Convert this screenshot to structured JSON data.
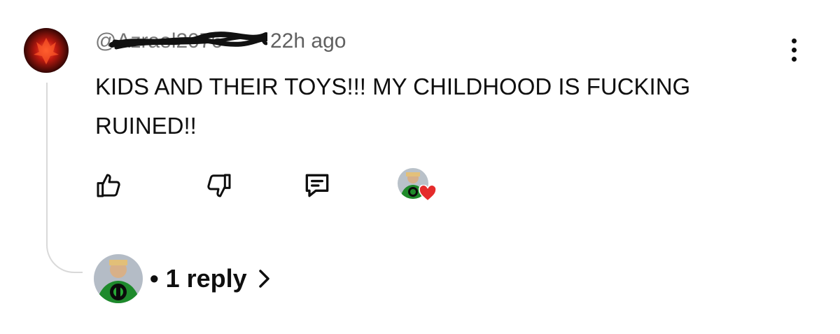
{
  "comment": {
    "author_handle": "@Azrael2076",
    "time_ago": "22h ago",
    "text": "KIDS AND THEIR TOYS!!! MY CHILDHOOD IS FUCKING RUINED!!"
  },
  "actions": {
    "like_icon": "thumbs-up-icon",
    "dislike_icon": "thumbs-down-icon",
    "reply_icon": "comment-icon",
    "creator_heart_icon": "heart-icon"
  },
  "replies": {
    "label": "• 1 reply"
  },
  "colors": {
    "heart": "#e52b2b",
    "thread_line": "#d9d9d9",
    "meta_text": "#606060"
  }
}
